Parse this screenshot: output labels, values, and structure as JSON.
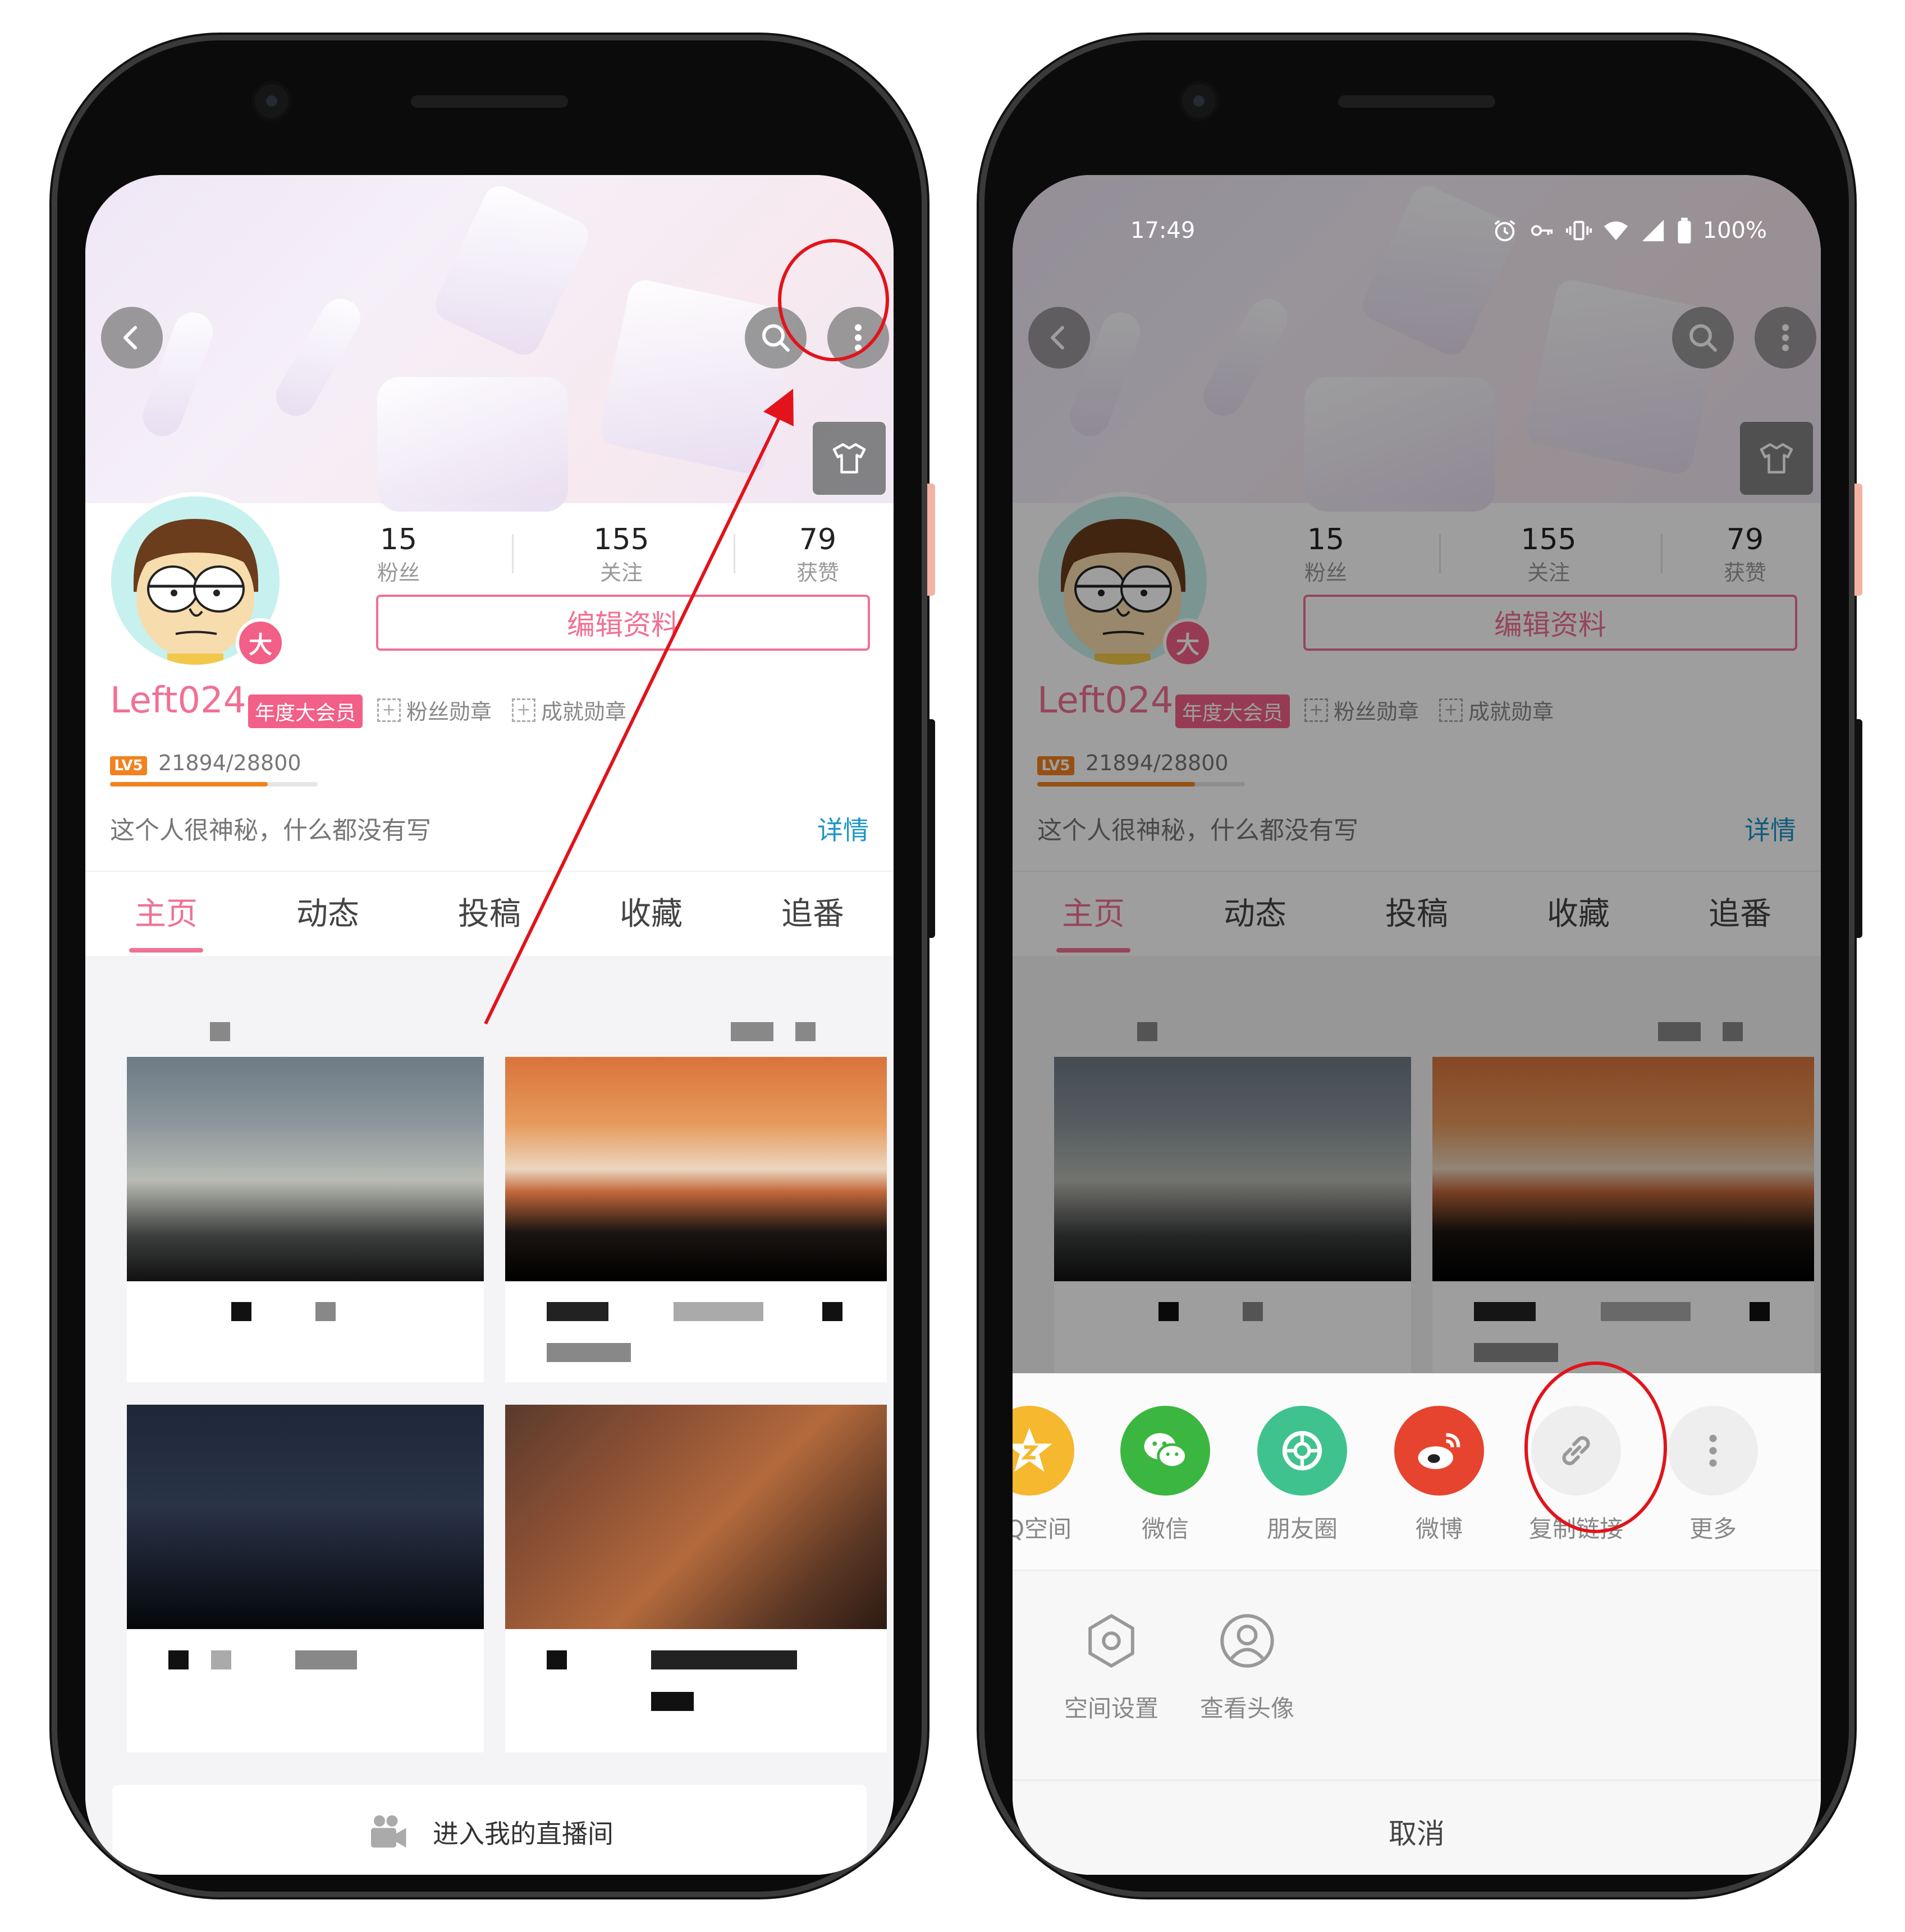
{
  "status_bar": {
    "time": "17:49",
    "battery": "100%"
  },
  "profile": {
    "stats": [
      {
        "num": "15",
        "label": "粉丝"
      },
      {
        "num": "155",
        "label": "关注"
      },
      {
        "num": "79",
        "label": "获赞"
      }
    ],
    "edit_label": "编辑资料",
    "username": "Left024",
    "vip": "年度大会员",
    "avatar_badge": "大",
    "fan_medal": "粉丝勋章",
    "achievement": "成就勋章",
    "level_badge": "LV5",
    "exp_text": "21894/28800",
    "exp_progress": 0.76,
    "bio": "这个人很神秘，什么都没有写",
    "detail": "详情"
  },
  "tabs": [
    "主页",
    "动态",
    "投稿",
    "收藏",
    "追番"
  ],
  "active_tab": "主页",
  "live": {
    "label": "进入我的直播间"
  },
  "share_sheet": {
    "share_items": [
      {
        "label": "QQ空间",
        "icon": "qzone-icon",
        "color": "#f5b82e"
      },
      {
        "label": "微信",
        "icon": "wechat-icon",
        "color": "#3bb640"
      },
      {
        "label": "朋友圈",
        "icon": "moments-icon",
        "color": "#3fc28e"
      },
      {
        "label": "微博",
        "icon": "weibo-icon",
        "color": "#e6442e"
      },
      {
        "label": "复制链接",
        "icon": "link-icon",
        "color": "#eeeeee"
      },
      {
        "label": "更多",
        "icon": "more-icon",
        "color": "#eeeeee"
      }
    ],
    "actions": [
      {
        "label": "空间设置",
        "icon": "hexagon-settings-icon"
      },
      {
        "label": "查看头像",
        "icon": "user-avatar-icon"
      }
    ],
    "cancel": "取消"
  },
  "colors": {
    "accent": "#f07194",
    "link": "#1e94c9",
    "annotation": "#e2131b"
  }
}
